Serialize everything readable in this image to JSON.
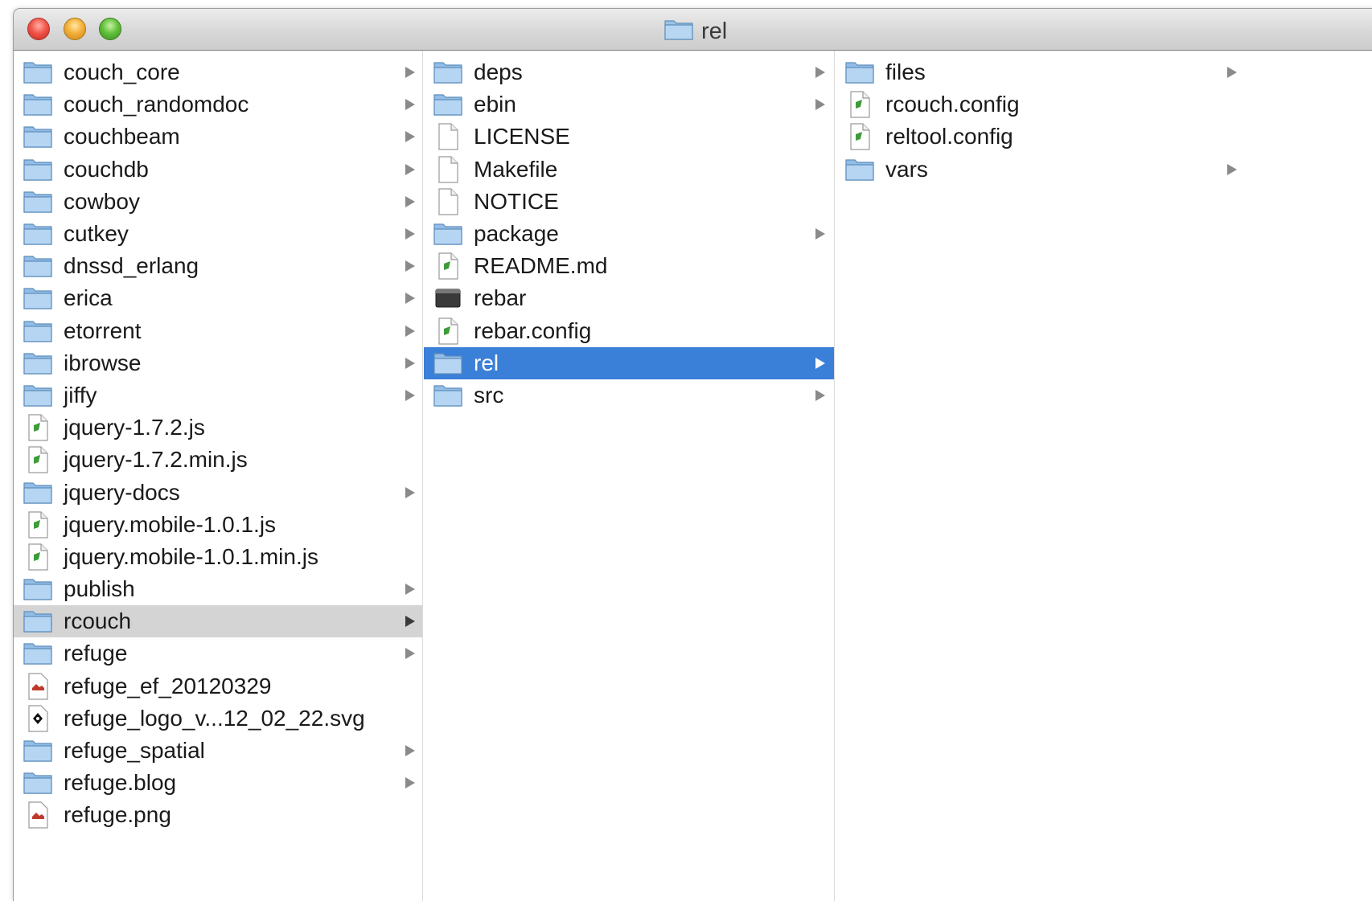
{
  "window": {
    "title": "rel"
  },
  "columns": [
    {
      "items": [
        {
          "label": "couch_core",
          "kind": "folder-icon",
          "has_children": true
        },
        {
          "label": "couch_randomdoc",
          "kind": "folder-icon",
          "has_children": true
        },
        {
          "label": "couchbeam",
          "kind": "folder-icon",
          "has_children": true
        },
        {
          "label": "couchdb",
          "kind": "folder-icon",
          "has_children": true
        },
        {
          "label": "cowboy",
          "kind": "folder-icon",
          "has_children": true
        },
        {
          "label": "cutkey",
          "kind": "folder-icon",
          "has_children": true
        },
        {
          "label": "dnssd_erlang",
          "kind": "folder-icon",
          "has_children": true
        },
        {
          "label": "erica",
          "kind": "folder-icon",
          "has_children": true
        },
        {
          "label": "etorrent",
          "kind": "folder-icon",
          "has_children": true
        },
        {
          "label": "ibrowse",
          "kind": "folder-icon",
          "has_children": true
        },
        {
          "label": "jiffy",
          "kind": "folder-icon",
          "has_children": true
        },
        {
          "label": "jquery-1.7.2.js",
          "kind": "script-file-icon",
          "has_children": false
        },
        {
          "label": "jquery-1.7.2.min.js",
          "kind": "script-file-icon",
          "has_children": false
        },
        {
          "label": "jquery-docs",
          "kind": "folder-icon",
          "has_children": true
        },
        {
          "label": "jquery.mobile-1.0.1.js",
          "kind": "script-file-icon",
          "has_children": false
        },
        {
          "label": "jquery.mobile-1.0.1.min.js",
          "kind": "script-file-icon",
          "has_children": false
        },
        {
          "label": "publish",
          "kind": "folder-icon",
          "has_children": true
        },
        {
          "label": "rcouch",
          "kind": "folder-icon",
          "has_children": true,
          "state": "open-path"
        },
        {
          "label": "refuge",
          "kind": "folder-icon",
          "has_children": true
        },
        {
          "label": "refuge_ef_20120329",
          "kind": "document-icon",
          "has_children": false
        },
        {
          "label": "refuge_logo_v...12_02_22.svg",
          "kind": "vector-file-icon",
          "has_children": false
        },
        {
          "label": "refuge_spatial",
          "kind": "folder-icon",
          "has_children": true
        },
        {
          "label": "refuge.blog",
          "kind": "folder-icon",
          "has_children": true
        },
        {
          "label": "refuge.png",
          "kind": "image-file-icon",
          "has_children": false
        }
      ]
    },
    {
      "items": [
        {
          "label": "deps",
          "kind": "folder-icon",
          "has_children": true
        },
        {
          "label": "ebin",
          "kind": "folder-icon",
          "has_children": true
        },
        {
          "label": "LICENSE",
          "kind": "plain-file-icon",
          "has_children": false
        },
        {
          "label": "Makefile",
          "kind": "plain-file-icon",
          "has_children": false
        },
        {
          "label": "NOTICE",
          "kind": "plain-file-icon",
          "has_children": false
        },
        {
          "label": "package",
          "kind": "folder-icon",
          "has_children": true
        },
        {
          "label": "README.md",
          "kind": "script-file-icon",
          "has_children": false
        },
        {
          "label": "rebar",
          "kind": "executable-icon",
          "has_children": false
        },
        {
          "label": "rebar.config",
          "kind": "script-file-icon",
          "has_children": false
        },
        {
          "label": "rel",
          "kind": "folder-icon",
          "has_children": true,
          "state": "selected"
        },
        {
          "label": "src",
          "kind": "folder-icon",
          "has_children": true
        }
      ]
    },
    {
      "items": [
        {
          "label": "files",
          "kind": "folder-icon",
          "has_children": true
        },
        {
          "label": "rcouch.config",
          "kind": "script-file-icon",
          "has_children": false
        },
        {
          "label": "reltool.config",
          "kind": "script-file-icon",
          "has_children": false
        },
        {
          "label": "vars",
          "kind": "folder-icon",
          "has_children": true
        }
      ]
    }
  ],
  "colors": {
    "selection": "#3a7fd8",
    "open_path": "#d4d4d4",
    "folder": "#8fbfe8"
  }
}
